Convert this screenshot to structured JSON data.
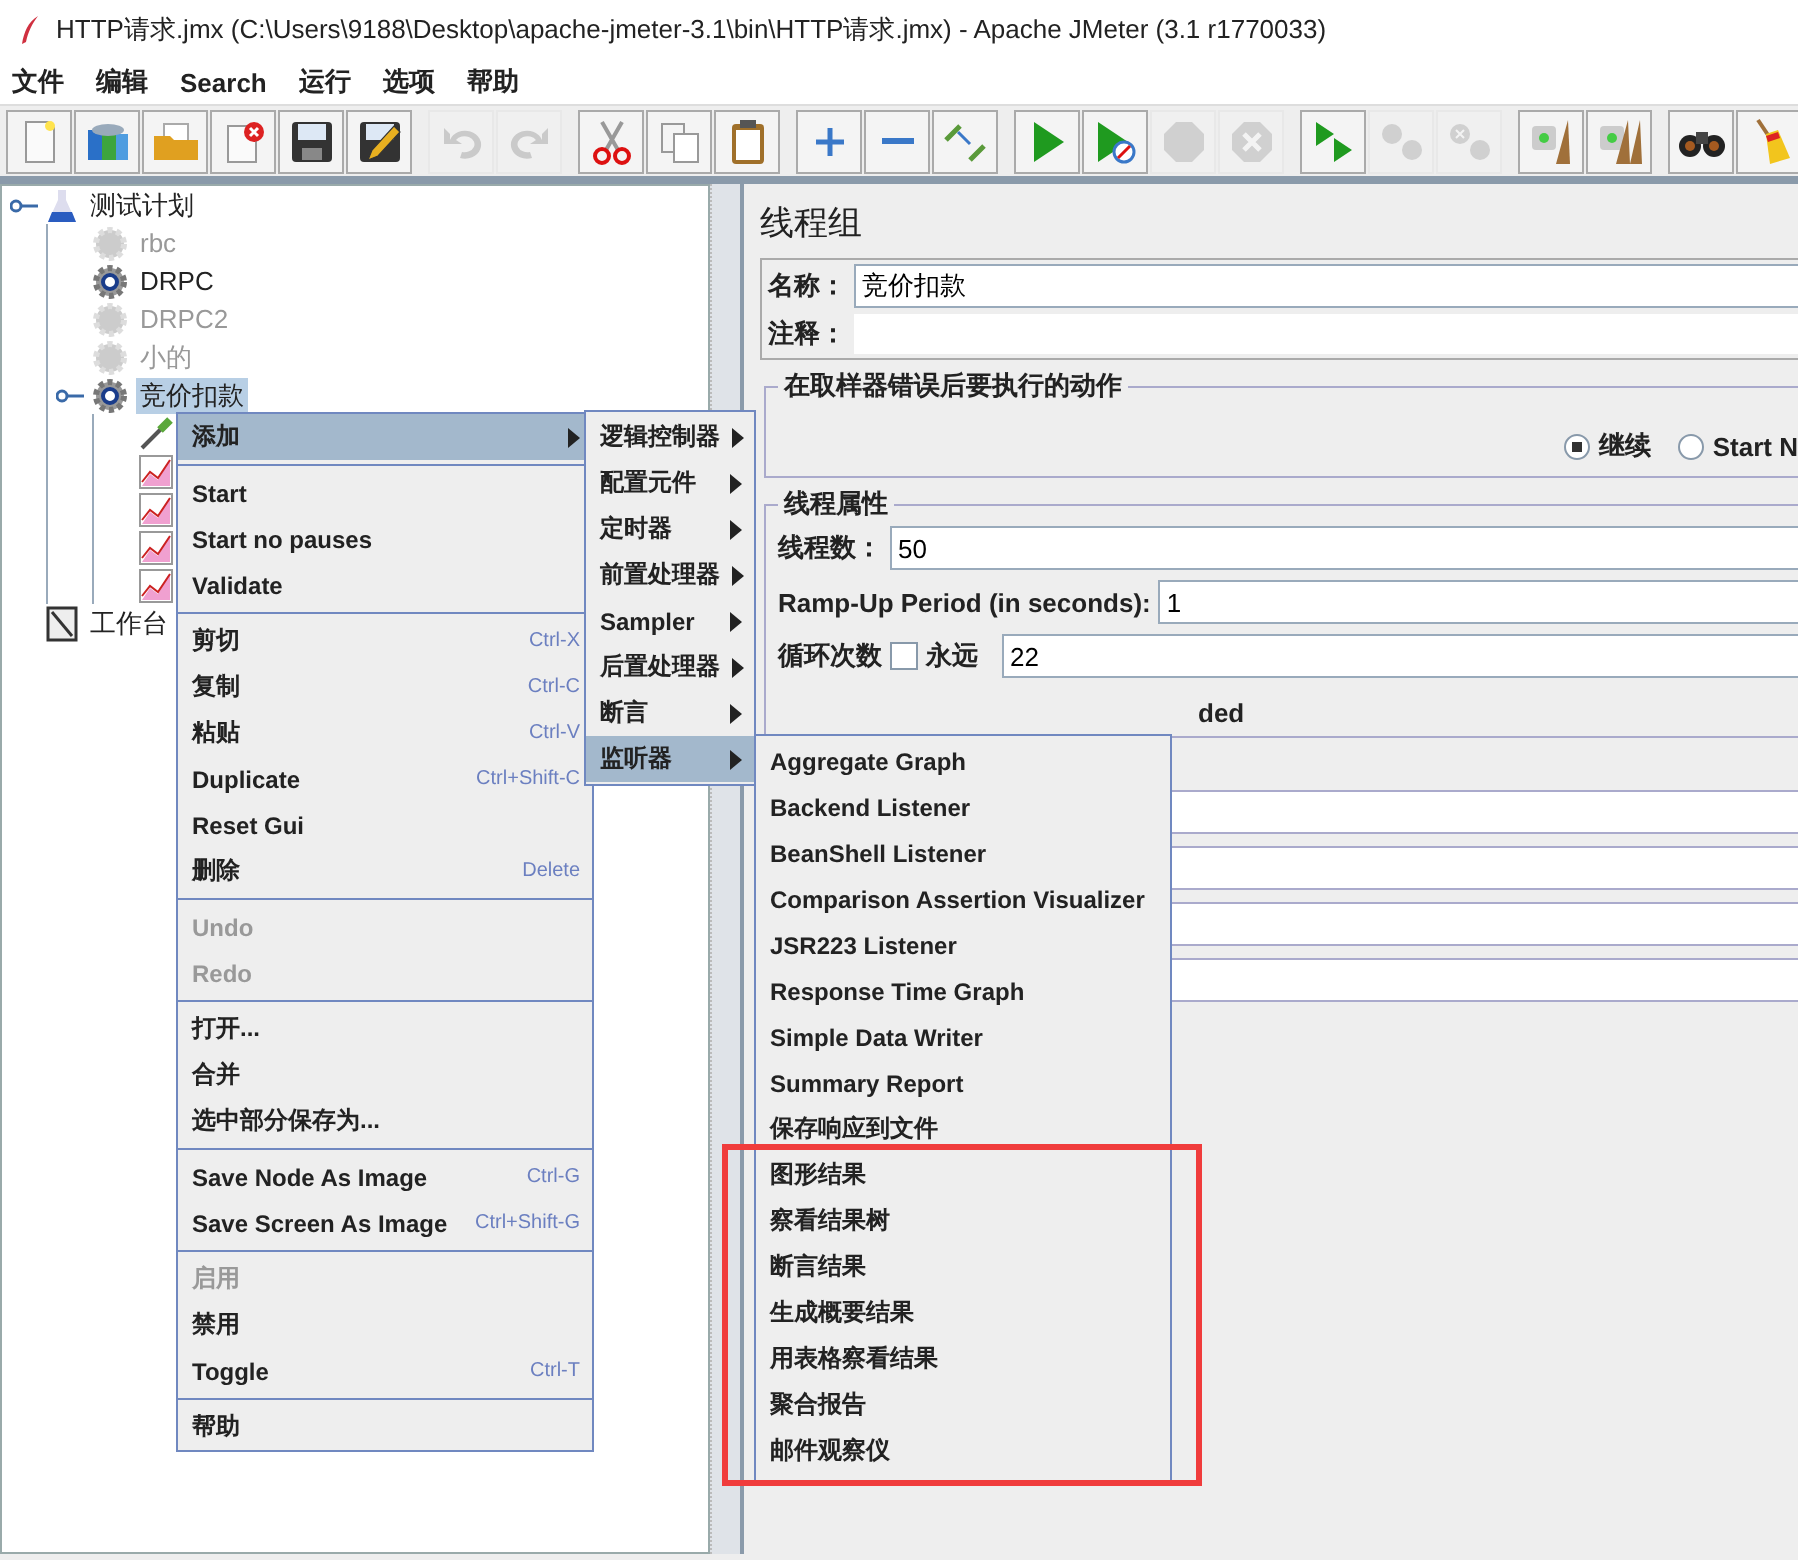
{
  "window": {
    "title": "HTTP请求.jmx (C:\\Users\\9188\\Desktop\\apache-jmeter-3.1\\bin\\HTTP请求.jmx) - Apache JMeter (3.1 r1770033)"
  },
  "menubar": [
    "文件",
    "编辑",
    "Search",
    "运行",
    "选项",
    "帮助"
  ],
  "toolbar": [
    [
      {
        "kind": "new",
        "disabled": false
      },
      {
        "kind": "templates",
        "disabled": false
      },
      {
        "kind": "open",
        "disabled": false
      },
      {
        "kind": "close",
        "disabled": false
      },
      {
        "kind": "save",
        "disabled": false
      },
      {
        "kind": "save_as",
        "disabled": false
      }
    ],
    [
      {
        "kind": "undo",
        "disabled": true
      },
      {
        "kind": "redo",
        "disabled": true
      }
    ],
    [
      {
        "kind": "cut",
        "disabled": false
      },
      {
        "kind": "copy",
        "disabled": false
      },
      {
        "kind": "paste",
        "disabled": false
      }
    ],
    [
      {
        "kind": "expand",
        "disabled": false
      },
      {
        "kind": "collapse",
        "disabled": false
      },
      {
        "kind": "toggle",
        "disabled": false
      }
    ],
    [
      {
        "kind": "start",
        "disabled": false
      },
      {
        "kind": "start_no_pauses",
        "disabled": false
      },
      {
        "kind": "stop",
        "disabled": true
      },
      {
        "kind": "shutdown",
        "disabled": true
      }
    ],
    [
      {
        "kind": "remote_start",
        "disabled": false
      },
      {
        "kind": "remote_stop",
        "disabled": true
      },
      {
        "kind": "remote_exit",
        "disabled": true
      }
    ],
    [
      {
        "kind": "clear",
        "disabled": false
      },
      {
        "kind": "clear_all",
        "disabled": false
      }
    ],
    [
      {
        "kind": "search",
        "disabled": false
      },
      {
        "kind": "reset_search",
        "disabled": false
      }
    ]
  ],
  "tree": [
    {
      "kind": "plan",
      "label": "测试计划",
      "disabled": false,
      "selected": false,
      "children": [
        {
          "kind": "thread_group",
          "label": "rbc",
          "disabled": true,
          "selected": false
        },
        {
          "kind": "thread_group",
          "label": "DRPC",
          "disabled": false,
          "selected": false
        },
        {
          "kind": "thread_group",
          "label": "DRPC2",
          "disabled": true,
          "selected": false
        },
        {
          "kind": "thread_group",
          "label": "小的",
          "disabled": true,
          "selected": false
        },
        {
          "kind": "thread_group",
          "label": "竞价扣款",
          "disabled": false,
          "selected": true,
          "children": [
            {
              "kind": "sampler"
            },
            {
              "kind": "listener"
            },
            {
              "kind": "listener"
            },
            {
              "kind": "listener"
            },
            {
              "kind": "listener"
            }
          ]
        }
      ]
    },
    {
      "kind": "workbench",
      "label": "工作台",
      "disabled": false,
      "selected": false
    }
  ],
  "panel": {
    "title": "线程组",
    "name_label": "名称：",
    "name_value": "竞价扣款",
    "comment_label": "注释：",
    "error_group": {
      "legend": "在取样器错误后要执行的动作",
      "options": [
        {
          "label": "继续",
          "selected": true
        },
        {
          "label": "Start N",
          "selected": false
        }
      ]
    },
    "thread_group": {
      "legend": "线程属性",
      "threads_label": "线程数：",
      "threads_value": "50",
      "rampup_label": "Ramp-Up Period (in seconds):",
      "rampup_value": "1",
      "loop_label": "循环次数",
      "forever_label": "永远",
      "forever_checked": false,
      "loop_value": "22",
      "partial_text": "ded"
    }
  },
  "context_menu": [
    [
      {
        "label": "添加",
        "selected": true,
        "submenu": true
      }
    ],
    [
      {
        "label": "Start",
        "selected": false
      },
      {
        "label": "Start no pauses",
        "selected": false
      },
      {
        "label": "Validate",
        "selected": false
      }
    ],
    [
      {
        "label": "剪切",
        "shortcut": "Ctrl-X",
        "selected": false
      },
      {
        "label": "复制",
        "shortcut": "Ctrl-C",
        "selected": false
      },
      {
        "label": "粘贴",
        "shortcut": "Ctrl-V",
        "selected": false
      },
      {
        "label": "Duplicate",
        "shortcut": "Ctrl+Shift-C",
        "selected": false
      },
      {
        "label": "Reset Gui",
        "selected": false
      },
      {
        "label": "删除",
        "shortcut": "Delete",
        "selected": false
      }
    ],
    [
      {
        "label": "Undo",
        "disabled": true,
        "selected": false
      },
      {
        "label": "Redo",
        "disabled": true,
        "selected": false
      }
    ],
    [
      {
        "label": "打开...",
        "selected": false
      },
      {
        "label": "合并",
        "selected": false
      },
      {
        "label": "选中部分保存为...",
        "selected": false
      }
    ],
    [
      {
        "label": "Save Node As Image",
        "shortcut": "Ctrl-G",
        "selected": false
      },
      {
        "label": "Save Screen As Image",
        "shortcut": "Ctrl+Shift-G",
        "selected": false
      }
    ],
    [
      {
        "label": "启用",
        "disabled": true,
        "selected": false
      },
      {
        "label": "禁用",
        "selected": false
      },
      {
        "label": "Toggle",
        "shortcut": "Ctrl-T",
        "selected": false
      }
    ],
    [
      {
        "label": "帮助",
        "selected": false
      }
    ]
  ],
  "add_submenu": [
    {
      "label": "逻辑控制器",
      "selected": false
    },
    {
      "label": "配置元件",
      "selected": false
    },
    {
      "label": "定时器",
      "selected": false
    },
    {
      "label": "前置处理器",
      "selected": false
    },
    {
      "label": "Sampler",
      "selected": false
    },
    {
      "label": "后置处理器",
      "selected": false
    },
    {
      "label": "断言",
      "selected": false
    },
    {
      "label": "监听器",
      "selected": true
    }
  ],
  "listener_submenu": [
    "Aggregate Graph",
    "Backend Listener",
    "BeanShell Listener",
    "Comparison Assertion Visualizer",
    "JSR223 Listener",
    "Response Time Graph",
    "Simple Data Writer",
    "Summary Report",
    "保存响应到文件",
    "图形结果",
    "察看结果树",
    "断言结果",
    "生成概要结果",
    "用表格察看结果",
    "聚合报告",
    "邮件观察仪"
  ]
}
